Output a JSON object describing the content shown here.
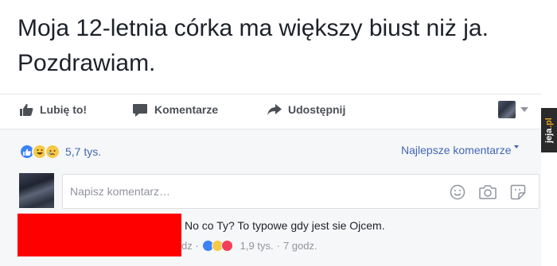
{
  "post": {
    "text_line1": "Moja 12-letnia córka ma większy biust niż ja.",
    "text_line2": "Pozdrawiam."
  },
  "actions": {
    "like_label": "Lubię to!",
    "comment_label": "Komentarze",
    "share_label": "Udostępnij"
  },
  "reactions": {
    "icons": [
      "like-icon",
      "haha-icon",
      "sad-icon"
    ],
    "count": "5,7 tys."
  },
  "sort": {
    "label": "Najlepsze komentarze"
  },
  "composer": {
    "placeholder": "Napisz komentarz…",
    "icons": [
      "emoji-icon",
      "camera-icon",
      "sticker-icon"
    ]
  },
  "comment": {
    "text": "No co Ty? To typowe gdy jest sie Ojcem.",
    "meta_prefix": "dz ·",
    "reaction_count": "1,9 tys.",
    "separator": "·",
    "time": "7 godz."
  },
  "watermark": {
    "text_main": "jeja",
    "text_accent": ".pl"
  },
  "colors": {
    "link": "#4267b2",
    "redaction": "#ff0000",
    "secondary_text": "#90949c"
  }
}
